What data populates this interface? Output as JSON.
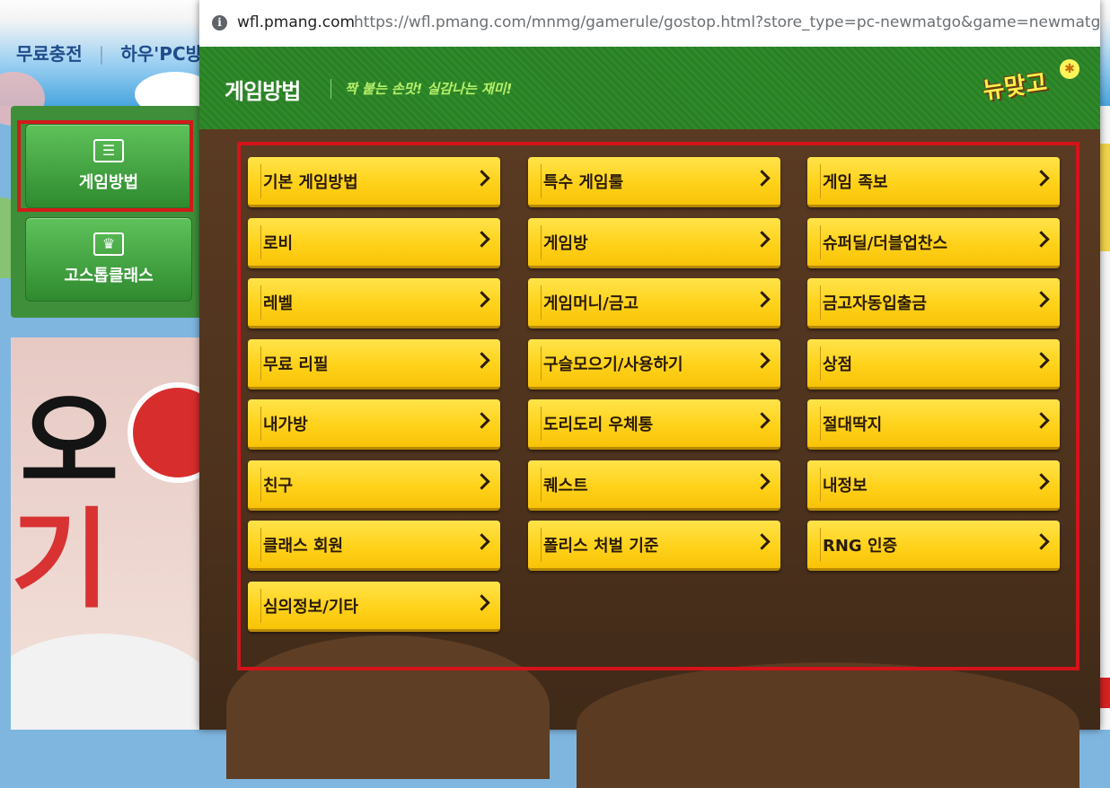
{
  "background": {
    "nav": {
      "charge": "무료충전",
      "separator": "|",
      "pc": "하우'PC방"
    },
    "side_buttons": {
      "howto": "게임방법",
      "class": "고스톱클래스"
    },
    "banner": {
      "char1": "오",
      "char2": "기적"
    }
  },
  "address_bar": {
    "domain": "wfl.pmang.com",
    "url": "https://wfl.pmang.com/mnmg/gamerule/gostop.html?store_type=pc-newmatgo&game=newmatgo&v"
  },
  "header": {
    "title": "게임방법",
    "tagline": "짝 붙는 손맛! 실감나는 재미!",
    "logo": "뉴맞고"
  },
  "colors": {
    "header_green": "#2f8a2a",
    "content_brown": "#4d321d",
    "button_yellow": "#ffd21a",
    "highlight_red": "#d4131a"
  },
  "menu": {
    "col1": [
      "기본 게임방법",
      "로비",
      "레벨",
      "무료 리필",
      "내가방",
      "친구",
      "클래스 회원",
      "심의정보/기타"
    ],
    "col2": [
      "특수 게임룰",
      "게임방",
      "게임머니/금고",
      "구슬모으기/사용하기",
      "도리도리 우체통",
      "퀘스트",
      "폴리스 처벌 기준"
    ],
    "col3": [
      "게임 족보",
      "슈퍼딜/더블업찬스",
      "금고자동입출금",
      "상점",
      "절대딱지",
      "내정보",
      "RNG 인증"
    ]
  }
}
